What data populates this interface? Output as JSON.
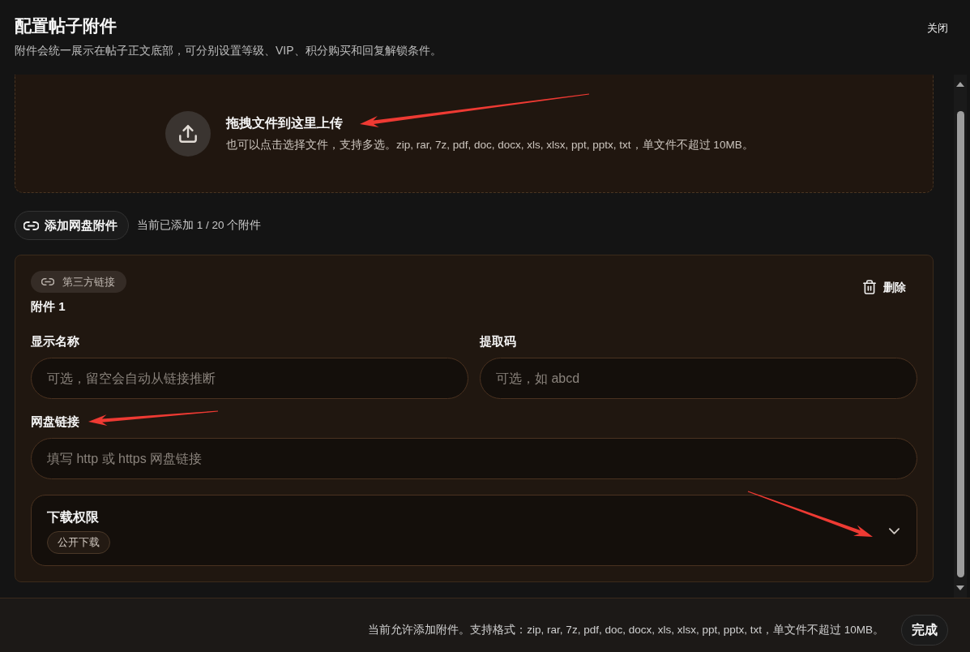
{
  "header": {
    "title": "配置帖子附件",
    "subtitle": "附件会统一展示在帖子正文底部，可分别设置等级、VIP、积分购买和回复解锁条件。",
    "close_label": "关闭"
  },
  "dropzone": {
    "title": "拖拽文件到这里上传",
    "hint": "也可以点击选择文件，支持多选。zip, rar, 7z, pdf, doc, docx, xls, xlsx, ppt, pptx, txt，单文件不超过 10MB。",
    "arrow": true
  },
  "toolbar": {
    "add_button": "添加网盘附件",
    "count": "当前已添加 1 / 20 个附件"
  },
  "attachments": [
    {
      "kind": "link",
      "source_tag": "第三方链接",
      "title": "附件 1",
      "delete_label": "删除",
      "field_rows": [
        [
          {
            "label": "显示名称",
            "placeholder": "可选，留空会自动从链接推断",
            "arrow": false
          },
          {
            "label": "提取码",
            "placeholder": "可选，如 abcd",
            "arrow": false
          }
        ],
        [
          {
            "label": "网盘链接",
            "placeholder": "填写 http 或 https 网盘链接",
            "arrow": true
          }
        ]
      ],
      "permission": {
        "label": "下载权限",
        "value": "公开下载",
        "expanded": false,
        "arrow": true
      }
    }
  ],
  "footer": {
    "note": "当前允许添加附件。支持格式：zip, rar, 7z, pdf, doc, docx, xls, xlsx, ppt, pptx, txt，单文件不超过 10MB。",
    "done_button": "完成"
  }
}
